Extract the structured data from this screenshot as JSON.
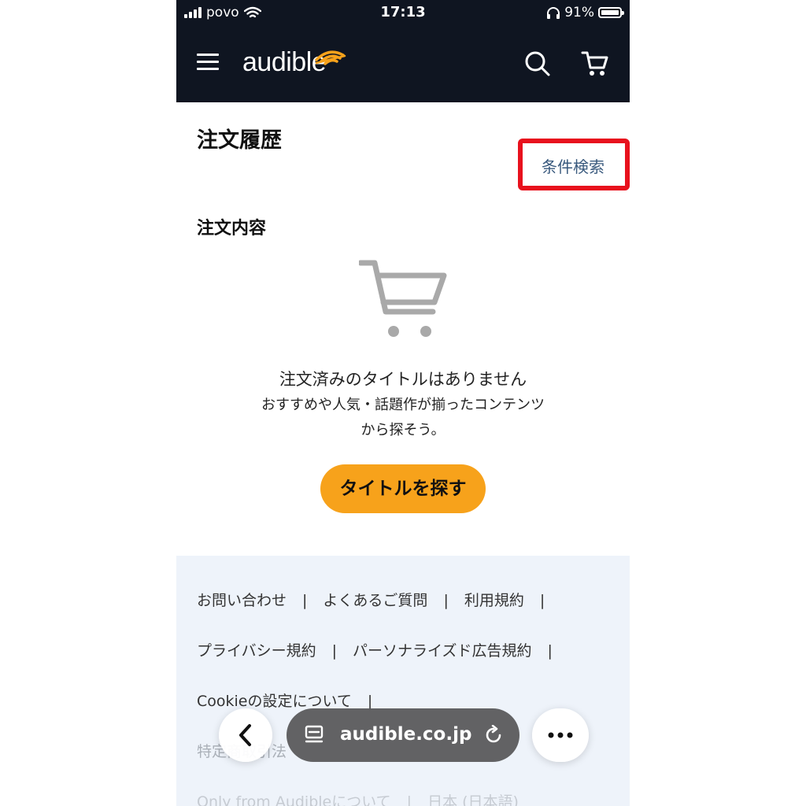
{
  "status_bar": {
    "carrier": "povo",
    "time": "17:13",
    "battery": "91%"
  },
  "header": {
    "logo": "audible",
    "menu_icon": "hamburger-icon",
    "search_icon": "search-icon",
    "cart_icon": "cart-icon"
  },
  "page": {
    "title": "注文履歴",
    "filter_link": "条件検索",
    "section_title": "注文内容",
    "empty_title": "注文済みのタイトルはありません",
    "empty_sub_line1": "おすすめや人気・話題作が揃ったコンテンツ",
    "empty_sub_line2": "から探そう。",
    "find_button": "タイトルを探す"
  },
  "footer": {
    "links": [
      "お問い合わせ",
      "よくあるご質問",
      "利用規約",
      "プライバシー規約",
      "パーソナライズド広告規約",
      "Cookieの設定について",
      "特定商取引法",
      "Only from Audibleについて",
      "日本 (日本語)"
    ]
  },
  "browser_bar": {
    "url": "audible.co.jp"
  },
  "colors": {
    "header_bg": "#0f1521",
    "accent_orange": "#f7a21b",
    "highlight_red": "#e8111d",
    "footer_bg": "#eef3fa"
  }
}
